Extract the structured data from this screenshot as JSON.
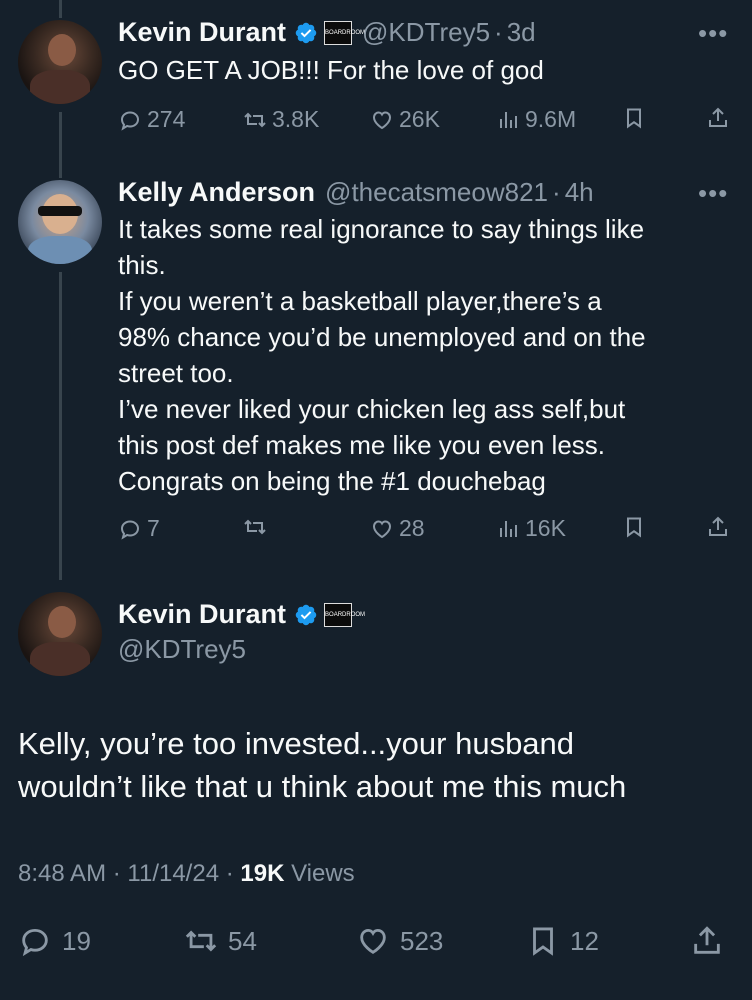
{
  "tweet1": {
    "name": "Kevin Durant",
    "handle": "@KDTrey5",
    "time": "3d",
    "badge_text": "BOARDROOM",
    "text": "GO GET A JOB!!! For the love of god",
    "replies": "274",
    "retweets": "3.8K",
    "likes": "26K",
    "views": "9.6M"
  },
  "tweet2": {
    "name": "Kelly Anderson",
    "handle": "@thecatsmeow821",
    "time": "4h",
    "lines": [
      "It takes some real ignorance to say things like",
      "this.",
      "If you weren’t a basketball player,there’s a",
      "98% chance you’d be unemployed and on the",
      "street too.",
      "I’ve never liked your chicken leg ass self,but",
      "this post def makes me like you even less.",
      "Congrats on being the #1 douchebag"
    ],
    "replies": "7",
    "likes": "28",
    "views": "16K"
  },
  "tweet3": {
    "name": "Kevin Durant",
    "handle": "@KDTrey5",
    "badge_text": "BOARDROOM",
    "lines": [
      "Kelly, you’re too invested...your husband",
      "wouldn’t like that u think about me this much"
    ],
    "time": "8:48 AM",
    "date": "11/14/24",
    "views_count": "19K",
    "views_label": "Views",
    "replies": "19",
    "retweets": "54",
    "likes": "523",
    "bookmarks": "12"
  },
  "separator": "·",
  "more_glyph": "•••"
}
